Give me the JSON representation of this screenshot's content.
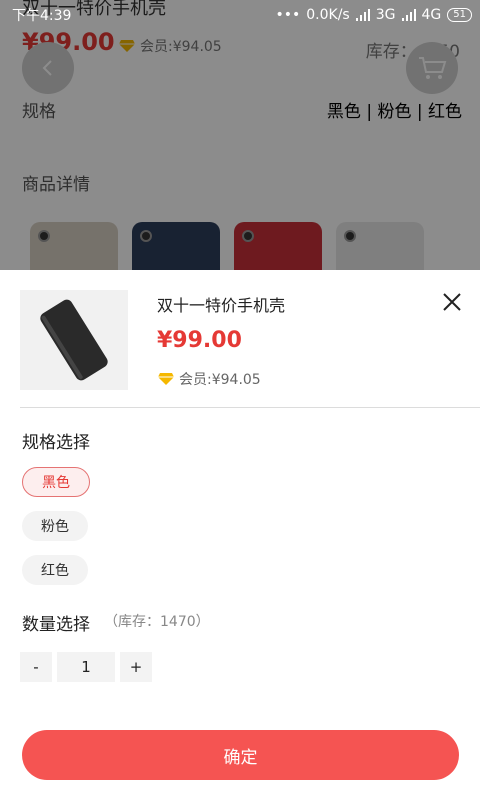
{
  "status_bar": {
    "time": "下午4:39",
    "network_speed": "0.0K/s",
    "network_1": "3G",
    "network_2": "4G",
    "battery": "51"
  },
  "background_page": {
    "title": "双十一特价手机壳",
    "price": "¥99.00",
    "member_price": "会员:¥94.05",
    "stock": "库存：4450",
    "spec_label": "规格",
    "spec_values": "黑色 | 粉色 | 红色",
    "detail_label": "商品详情",
    "case_colors": [
      "#d8cfc4",
      "#2d3e5c",
      "#c8303a",
      "#e7e7e7"
    ]
  },
  "sheet": {
    "product_title": "双十一特价手机壳",
    "price": "¥99.00",
    "member_price": "会员:¥94.05",
    "spec_title": "规格选择",
    "specs": [
      {
        "label": "黑色",
        "selected": true
      },
      {
        "label": "粉色",
        "selected": false
      },
      {
        "label": "红色",
        "selected": false
      }
    ],
    "qty_title": "数量选择",
    "qty_stock": "（库存：1470）",
    "qty_minus": "-",
    "qty_value": "1",
    "qty_plus": "+",
    "confirm_label": "确定"
  },
  "colors": {
    "accent_red": "#e53935",
    "confirm_button": "#f55452",
    "vip_gold": "#f5b800"
  },
  "icons": {
    "back": "chevron-left-icon",
    "cart": "cart-icon",
    "close": "close-icon",
    "vip": "diamond-icon"
  }
}
